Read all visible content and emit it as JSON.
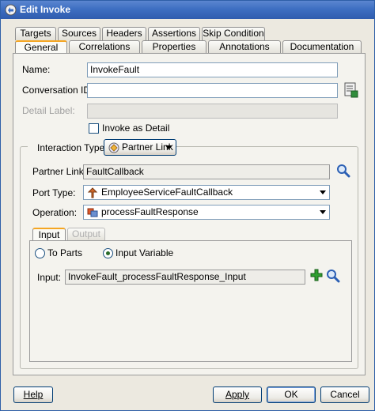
{
  "window": {
    "title": "Edit Invoke"
  },
  "tabs_row1": [
    {
      "label": "Targets"
    },
    {
      "label": "Sources"
    },
    {
      "label": "Headers"
    },
    {
      "label": "Assertions"
    },
    {
      "label": "Skip Condition"
    }
  ],
  "tabs_row2": [
    {
      "label": "General",
      "active": true
    },
    {
      "label": "Correlations"
    },
    {
      "label": "Properties"
    },
    {
      "label": "Annotations"
    },
    {
      "label": "Documentation"
    }
  ],
  "general": {
    "name_label": "Name:",
    "name_value": "InvokeFault",
    "conversation_label": "Conversation ID:",
    "conversation_value": "",
    "detail_label": "Detail Label:",
    "detail_value": "",
    "invoke_as_detail_label": "Invoke as Detail",
    "invoke_as_detail_checked": false
  },
  "interaction": {
    "type_label": "Interaction Type:",
    "type_value": "Partner Link",
    "partner_link_label": "Partner Link:",
    "partner_link_value": "FaultCallback",
    "port_type_label": "Port Type:",
    "port_type_value": "EmployeeServiceFaultCallback",
    "operation_label": "Operation:",
    "operation_value": "processFaultResponse"
  },
  "io_tabs": [
    {
      "label": "Input",
      "active": true
    },
    {
      "label": "Output",
      "active": false
    }
  ],
  "input": {
    "to_parts_label": "To Parts",
    "input_variable_label": "Input Variable",
    "selected": "Input Variable",
    "input_label": "Input:",
    "input_value": "InvokeFault_processFaultResponse_Input"
  },
  "buttons": {
    "help": "Help",
    "apply": "Apply",
    "ok": "OK",
    "cancel": "Cancel"
  },
  "colors": {
    "titlebar": "#3e6fc2",
    "tab_active_accent": "#f5a623",
    "add_icon": "#2f9e2f",
    "search_icon": "#2b5fb4"
  }
}
